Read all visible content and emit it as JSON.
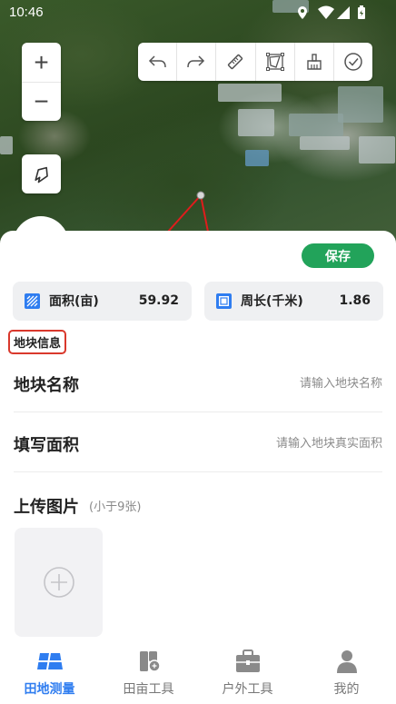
{
  "status_bar": {
    "time": "10:46"
  },
  "map": {
    "zoom_in_label": "+",
    "zoom_out_label": "−"
  },
  "actions": {
    "save_label": "保存"
  },
  "stats": [
    {
      "label": "面积(亩)",
      "value": "59.92",
      "icon": "area-icon"
    },
    {
      "label": "周长(千米)",
      "value": "1.86",
      "icon": "perimeter-icon"
    }
  ],
  "section": {
    "title": "地块信息"
  },
  "form": {
    "name": {
      "label": "地块名称",
      "placeholder": "请输入地块名称"
    },
    "area": {
      "label": "填写面积",
      "placeholder": "请输入地块真实面积"
    },
    "upload": {
      "label": "上传图片",
      "hint": "(小于9张)"
    }
  },
  "nav": [
    {
      "label": "田地测量",
      "icon": "field-measure-icon",
      "active": true
    },
    {
      "label": "田亩工具",
      "icon": "field-tools-icon",
      "active": false
    },
    {
      "label": "户外工具",
      "icon": "outdoor-toolbox-icon",
      "active": false
    },
    {
      "label": "我的",
      "icon": "profile-icon",
      "active": false
    }
  ],
  "colors": {
    "accent": "#2f7df0",
    "save": "#22a35a",
    "highlight_border": "#d9382c",
    "polygon_line": "#e01c1c"
  }
}
